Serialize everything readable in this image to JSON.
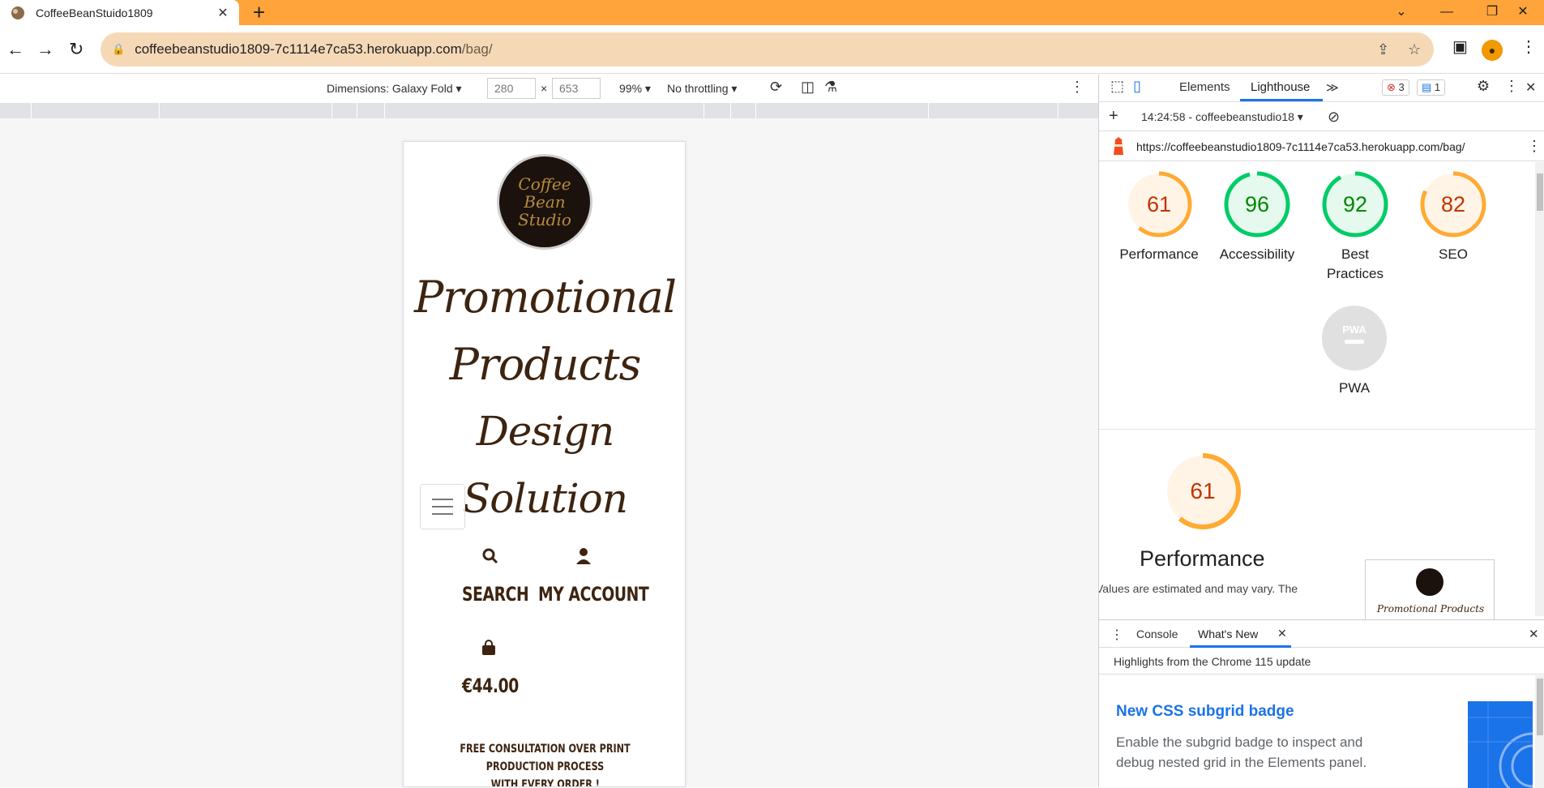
{
  "browser": {
    "tab_title": "CoffeeBeanStuido1809",
    "tab_close": "✕",
    "new_tab": "+",
    "url_host": "coffeebeanstudio1809-7c1114e7ca53.herokuapp.com",
    "url_path": "/bag/"
  },
  "device_toolbar": {
    "dimensions_label": "Dimensions: Galaxy Fold",
    "width": "280",
    "times": "×",
    "height": "653",
    "zoom": "99%",
    "throttling": "No throttling"
  },
  "site": {
    "logo_text": "Coffee Bean Studio",
    "headline_lines": [
      "Promotional",
      "Products",
      "Design Solution"
    ],
    "nav": {
      "search": "SEARCH",
      "account": "MY ACCOUNT",
      "bag_total": "€44.00"
    },
    "promo_lines": [
      "FREE CONSULTATION OVER PRINT PRODUCTION PROCESS",
      "WITH EVERY ORDER !"
    ]
  },
  "devtools": {
    "tabs": [
      "Elements",
      "Lighthouse"
    ],
    "more": "≫",
    "errors": "3",
    "messages": "1",
    "report_selector": "14:24:58 - coffeebeanstudio18",
    "report_url": "https://coffeebeanstudio1809-7c1114e7ca53.herokuapp.com/bag/",
    "scores": [
      {
        "label": "Performance",
        "value": 61,
        "color": "#fa3"
      },
      {
        "label": "Accessibility",
        "value": 96,
        "color": "#0c6"
      },
      {
        "label": "Best Practices",
        "value": 92,
        "color": "#0c6"
      },
      {
        "label": "SEO",
        "value": 82,
        "color": "#fa3"
      }
    ],
    "pwa_badge": "PWA",
    "pwa_label": "PWA",
    "perf_score": 61,
    "perf_title": "Performance",
    "perf_note": "Values are estimated and may vary. The",
    "thumb_headline": "Promotional Products Design Solution",
    "drawer": {
      "tabs": [
        "Console",
        "What's New"
      ],
      "highlights": "Highlights from the Chrome 115 update",
      "article_title": "New CSS subgrid badge",
      "article_body": "Enable the subgrid badge to inspect and debug nested grid in the Elements panel."
    }
  },
  "colors": {
    "tabstrip": "#ffa43a",
    "omnibox": "#f5d9b6",
    "brand_brown": "#3d2410",
    "good": "#0c6",
    "average": "#fa3"
  }
}
